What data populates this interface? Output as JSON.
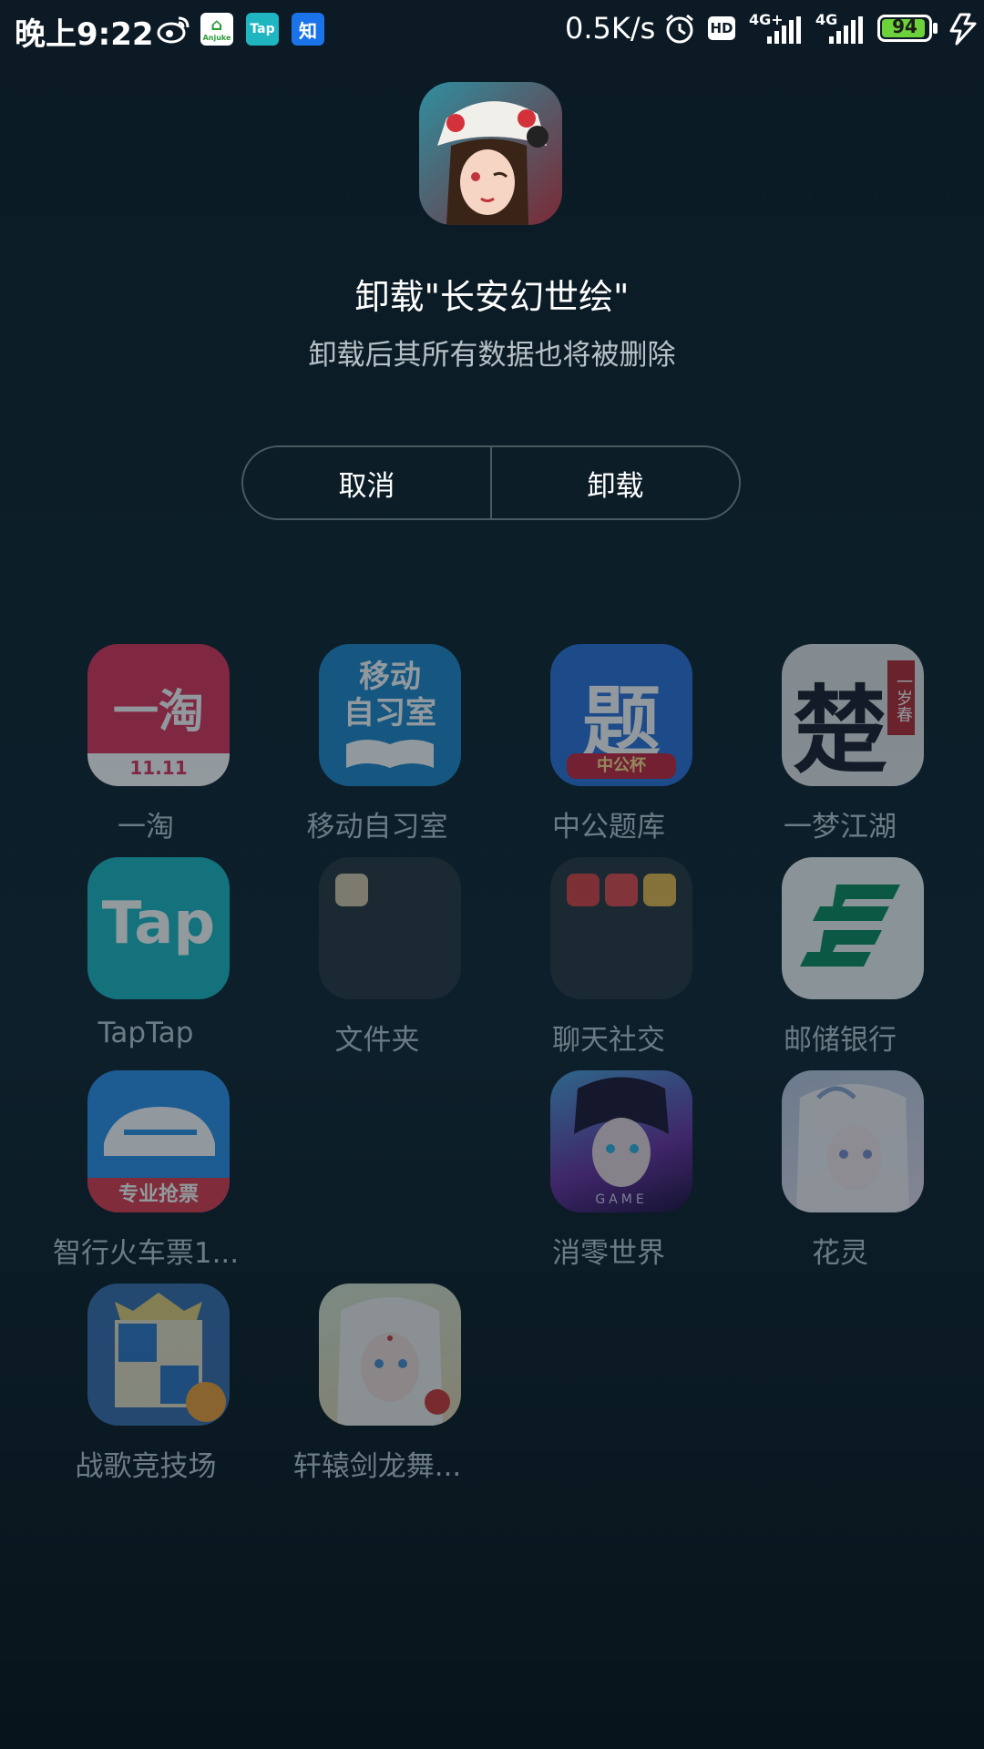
{
  "status_bar": {
    "time": "晚上9:22",
    "net_speed": "0.5K/s",
    "hd": "HD",
    "signal1": "4G+",
    "signal2": "4G",
    "battery": "94",
    "anjuke": "Anjuke",
    "tap": "Tap",
    "zhi": "知"
  },
  "dialog": {
    "app_name": "长安幻世绘",
    "title": "卸载\"长安幻世绘\"",
    "subtitle": "卸载后其所有数据也将被删除",
    "cancel_label": "取消",
    "uninstall_label": "卸载"
  },
  "apps": [
    {
      "label": "一淘",
      "icon_text": "一淘",
      "badge": "11.11",
      "color": "#e02f56"
    },
    {
      "label": "移动自习室",
      "icon_text": "移动\n自习室",
      "color": "#1e86c9"
    },
    {
      "label": "中公题库",
      "icon_text": "题",
      "badge": "中公杯",
      "color": "#2b6fd8"
    },
    {
      "label": "一梦江湖",
      "icon_text": "楚",
      "badge": "一岁春",
      "color": "#e6e4e6"
    },
    {
      "label": "TapTap",
      "icon_text": "Tap",
      "color": "#1ab6c2"
    },
    {
      "label": "文件夹",
      "color": "#26323a"
    },
    {
      "label": "聊天社交",
      "color": "#26323a"
    },
    {
      "label": "邮储银行",
      "color": "#f1f4f3"
    },
    {
      "label": "智行火车票1...",
      "badge": "专业抢票",
      "color": "#2a8fe8"
    },
    {
      "label": "消零世界",
      "badge": "GAME",
      "color": "#4a3a9a"
    },
    {
      "label": "花灵",
      "color": "#cfc4d8"
    },
    {
      "label": "战歌竞技场",
      "color": "#3a6fb0"
    },
    {
      "label": "轩辕剑龙舞...",
      "color": "#d9d2c4"
    }
  ]
}
